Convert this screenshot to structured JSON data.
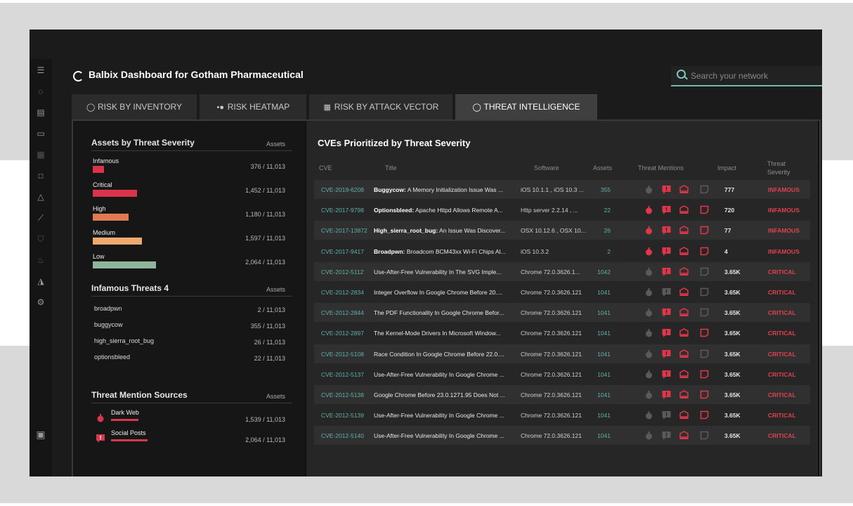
{
  "app": {
    "title": "Balbix Dashboard for Gotham Pharmaceutical",
    "search_placeholder": "Search your network"
  },
  "tabs": [
    {
      "label": "RISK BY INVENTORY",
      "icon": "ring-icon",
      "active": false
    },
    {
      "label": "RISK HEATMAP",
      "icon": "heatmap-icon",
      "active": false
    },
    {
      "label": "RISK BY ATTACK VECTOR",
      "icon": "grid-icon",
      "active": false
    },
    {
      "label": "THREAT INTELLIGENCE",
      "icon": "ring-icon",
      "active": true
    }
  ],
  "sidebar": {
    "icons": [
      "menu-icon",
      "ring-icon",
      "inventory-icon",
      "devices-icon",
      "grid-icon",
      "camera-icon",
      "warning-icon",
      "trend-icon",
      "shield-icon",
      "fire-icon",
      "bell-icon",
      "gear-icon",
      "panel-icon"
    ]
  },
  "severity_panel": {
    "title": "Assets by Threat Severity",
    "col": "Assets",
    "items": [
      {
        "label": "Infamous",
        "count": "376 / 11,013",
        "value": 376,
        "color": "#d9344a"
      },
      {
        "label": "Critical",
        "count": "1,452 / 11,013",
        "value": 1452,
        "color": "#d9344a"
      },
      {
        "label": "High",
        "count": "1,180 / 11,013",
        "value": 1180,
        "color": "#e07a52"
      },
      {
        "label": "Medium",
        "count": "1,597 / 11,013",
        "value": 1597,
        "color": "#eeaa6e"
      },
      {
        "label": "Low",
        "count": "2,064 / 11,013",
        "value": 2064,
        "color": "#8fb59a"
      }
    ]
  },
  "infamous_panel": {
    "title": "Infamous Threats 4",
    "col": "Assets",
    "items": [
      {
        "name": "broadpwn",
        "count": "2 / 11,013"
      },
      {
        "name": "buggycow",
        "count": "355 / 11,013"
      },
      {
        "name": "high_sierra_root_bug",
        "count": "26 / 11,013"
      },
      {
        "name": "optionsbleed",
        "count": "22 / 11,013"
      }
    ]
  },
  "sources_panel": {
    "title": "Threat Mention Sources",
    "col": "Assets",
    "items": [
      {
        "name": "Dark Web",
        "count": "1,539 / 11,013",
        "icon": "bomb-icon",
        "value": 1539
      },
      {
        "name": "Social Posts",
        "count": "2,064 / 11,013",
        "icon": "chat-alert-icon",
        "value": 2064
      }
    ]
  },
  "cve_table": {
    "title": "CVEs Prioritized by Threat Severity",
    "headers": {
      "cve": "CVE",
      "title": "Title",
      "software": "Software",
      "assets": "Assets",
      "mentions": "Threat Mentions",
      "impact": "Impact",
      "severity": "Threat Severity"
    },
    "rows": [
      {
        "cve": "CVE-2019-6208",
        "name": "Buggycow:",
        "title": " A Memory Initialization Issue Was ...",
        "software": "iOS 10.1.1 , iOS 10.3 ...",
        "assets": "355",
        "impact": "777",
        "severity": "INFAMOUS",
        "mentions": [
          0,
          1,
          1,
          0
        ]
      },
      {
        "cve": "CVE-2017-9798",
        "name": "Optionsbleed:",
        "title": " Apache Httpd Allows Remote A...",
        "software": "Http server 2.2.14 , ...",
        "assets": "22",
        "impact": "720",
        "severity": "INFAMOUS",
        "mentions": [
          1,
          1,
          1,
          1
        ]
      },
      {
        "cve": "CVE-2017-13872",
        "name": "High_sierra_root_bug:",
        "title": " An Issue Was Discover...",
        "software": "OSX 10.12.6 , OSX 10...",
        "assets": "26",
        "impact": "77",
        "severity": "INFAMOUS",
        "mentions": [
          1,
          1,
          1,
          1
        ]
      },
      {
        "cve": "CVE-2017-9417",
        "name": "Broadpwn:",
        "title": " Broadcom BCM43xx Wi-Fi Chips Al...",
        "software": "iOS 10.3.2",
        "assets": "2",
        "impact": "4",
        "severity": "INFAMOUS",
        "mentions": [
          1,
          1,
          1,
          1
        ]
      },
      {
        "cve": "CVE-2012-5112",
        "name": "",
        "title": "Use-After-Free Vulnerability In The SVG Imple...",
        "software": "Chrome 72.0.3626.1...",
        "assets": "1042",
        "impact": "3.65K",
        "severity": "CRITICAL",
        "mentions": [
          0,
          1,
          1,
          0
        ]
      },
      {
        "cve": "CVE-2012-2834",
        "name": "",
        "title": "Integer Overflow In Google Chrome Before 20....",
        "software": "Chrome 72.0.3626.121",
        "assets": "1041",
        "impact": "3.65K",
        "severity": "CRITICAL",
        "mentions": [
          0,
          0,
          1,
          0
        ]
      },
      {
        "cve": "CVE-2012-2844",
        "name": "",
        "title": "The PDF Functionality In Google Chrome Befor...",
        "software": "Chrome 72.0.3626.121",
        "assets": "1041",
        "impact": "3.65K",
        "severity": "CRITICAL",
        "mentions": [
          0,
          1,
          1,
          0
        ]
      },
      {
        "cve": "CVE-2012-2897",
        "name": "",
        "title": "The Kernel-Mode Drivers In Microsoft Window...",
        "software": "Chrome 72.0.3626.121",
        "assets": "1041",
        "impact": "3.65K",
        "severity": "CRITICAL",
        "mentions": [
          0,
          1,
          1,
          1
        ]
      },
      {
        "cve": "CVE-2012-5108",
        "name": "",
        "title": "Race Condition In Google Chrome Before 22.0....",
        "software": "Chrome 72.0.3626.121",
        "assets": "1041",
        "impact": "3.65K",
        "severity": "CRITICAL",
        "mentions": [
          0,
          1,
          1,
          0
        ]
      },
      {
        "cve": "CVE-2012-5137",
        "name": "",
        "title": "Use-After-Free Vulnerability In Google Chrome ...",
        "software": "Chrome 72.0.3626.121",
        "assets": "1041",
        "impact": "3.65K",
        "severity": "CRITICAL",
        "mentions": [
          0,
          1,
          1,
          1
        ]
      },
      {
        "cve": "CVE-2012-5138",
        "name": "",
        "title": "Google Chrome Before 23.0.1271.95 Does Not ...",
        "software": "Chrome 72.0.3626.121",
        "assets": "1041",
        "impact": "3.65K",
        "severity": "CRITICAL",
        "mentions": [
          0,
          1,
          1,
          1
        ]
      },
      {
        "cve": "CVE-2012-5139",
        "name": "",
        "title": "Use-After-Free Vulnerability In Google Chrome ...",
        "software": "Chrome 72.0.3626.121",
        "assets": "1041",
        "impact": "3.65K",
        "severity": "CRITICAL",
        "mentions": [
          0,
          0,
          1,
          1
        ]
      },
      {
        "cve": "CVE-2012-5140",
        "name": "",
        "title": "Use-After-Free Vulnerability In Google Chrome ...",
        "software": "Chrome 72.0.3626.121",
        "assets": "1041",
        "impact": "3.65K",
        "severity": "CRITICAL",
        "mentions": [
          0,
          0,
          1,
          0
        ]
      }
    ]
  },
  "colors": {
    "accent": "#5fb0a8",
    "alert": "#d9344a",
    "active_tab": "#3f3f3f"
  }
}
